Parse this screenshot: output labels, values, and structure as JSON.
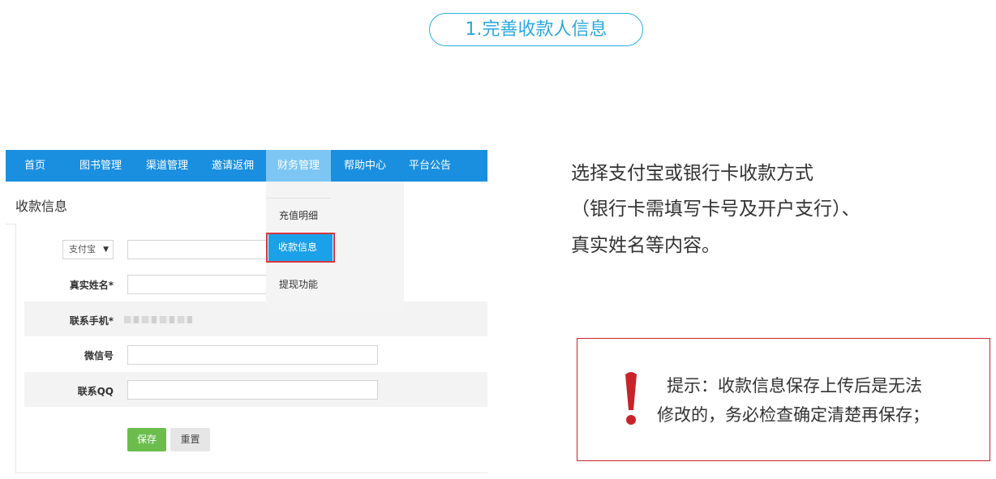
{
  "step": {
    "title": "1.完善收款人信息"
  },
  "app": {
    "nav": [
      "首页",
      "图书管理",
      "渠道管理",
      "邀请返佣",
      "财务管理",
      "帮助中心",
      "平台公告"
    ],
    "active_nav": "财务管理",
    "page_title": "收款信息",
    "dropdown": {
      "items": [
        "充值明细",
        "收款信息",
        "提现功能"
      ],
      "selected": "收款信息"
    },
    "form": {
      "payment_method": "支付宝",
      "labels": {
        "name": "真实姓名*",
        "phone": "联系手机*",
        "wechat": "微信号",
        "qq": "联系QQ"
      },
      "buttons": {
        "save": "保存",
        "reset": "重置"
      }
    }
  },
  "description": [
    "选择支付宝或银行卡收款方式",
    "（银行卡需填写卡号及开户支行）、",
    "真实姓名等内容。"
  ],
  "tip": {
    "lines": [
      "提示：收款信息保存上传后是无法",
      "修改的，务必检查确定清楚再保存；"
    ]
  },
  "colors": {
    "accent": "#1a8fe0",
    "pill": "#29aee6",
    "save": "#6cbd4d",
    "tip_border": "#c8232b"
  }
}
